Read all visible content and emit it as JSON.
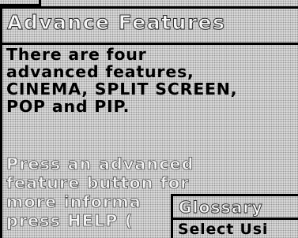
{
  "panel": {
    "title": "Advance Features",
    "description": "There are four\nadvanced features,\nCINEMA, SPLIT SCREEN,\nPOP and PIP.",
    "instruction": "Press an advanced\nfeature button for\nmore informa\npress HELP ("
  },
  "glossary": {
    "title": "Glossary",
    "prompt": "Select Usi"
  }
}
